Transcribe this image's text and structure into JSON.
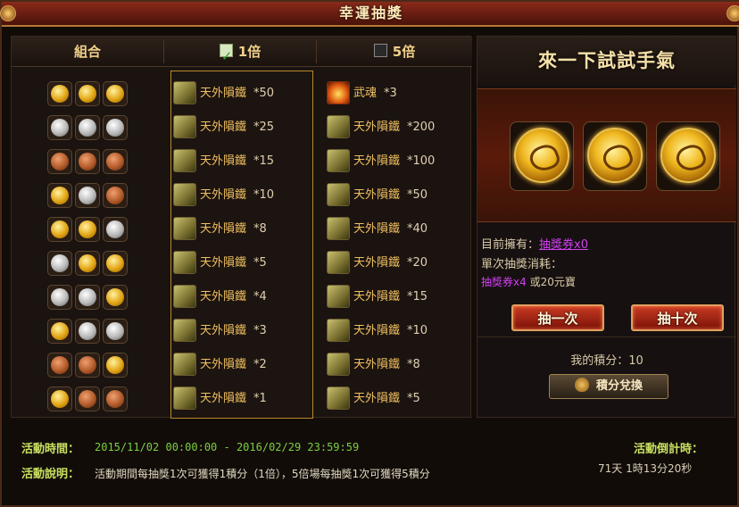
{
  "window": {
    "title": "幸運抽獎"
  },
  "table": {
    "headers": {
      "combo": "組合",
      "x1": "1倍",
      "x5": "5倍"
    },
    "x1_checked": true,
    "x5_checked": false,
    "rows": [
      {
        "coins": [
          "gold",
          "gold",
          "gold"
        ],
        "x1": {
          "name": "天外隕鐵",
          "qty": "*50"
        },
        "x5": {
          "name": "武魂",
          "qty": "*3",
          "icon": "fire-orb-icon"
        }
      },
      {
        "coins": [
          "silver",
          "silver",
          "silver"
        ],
        "x1": {
          "name": "天外隕鐵",
          "qty": "*25"
        },
        "x5": {
          "name": "天外隕鐵",
          "qty": "*200",
          "icon": "meteor-iron-icon"
        }
      },
      {
        "coins": [
          "bronze",
          "bronze",
          "bronze"
        ],
        "x1": {
          "name": "天外隕鐵",
          "qty": "*15"
        },
        "x5": {
          "name": "天外隕鐵",
          "qty": "*100",
          "icon": "meteor-iron-icon"
        }
      },
      {
        "coins": [
          "gold",
          "silver",
          "bronze"
        ],
        "x1": {
          "name": "天外隕鐵",
          "qty": "*10"
        },
        "x5": {
          "name": "天外隕鐵",
          "qty": "*50",
          "icon": "meteor-iron-icon"
        }
      },
      {
        "coins": [
          "gold",
          "gold",
          "silver"
        ],
        "x1": {
          "name": "天外隕鐵",
          "qty": "*8"
        },
        "x5": {
          "name": "天外隕鐵",
          "qty": "*40",
          "icon": "meteor-iron-icon"
        }
      },
      {
        "coins": [
          "silver",
          "gold",
          "gold"
        ],
        "x1": {
          "name": "天外隕鐵",
          "qty": "*5"
        },
        "x5": {
          "name": "天外隕鐵",
          "qty": "*20",
          "icon": "meteor-iron-icon"
        }
      },
      {
        "coins": [
          "silver",
          "silver",
          "gold"
        ],
        "x1": {
          "name": "天外隕鐵",
          "qty": "*4"
        },
        "x5": {
          "name": "天外隕鐵",
          "qty": "*15",
          "icon": "meteor-iron-icon"
        }
      },
      {
        "coins": [
          "gold",
          "silver",
          "silver"
        ],
        "x1": {
          "name": "天外隕鐵",
          "qty": "*3"
        },
        "x5": {
          "name": "天外隕鐵",
          "qty": "*10",
          "icon": "meteor-iron-icon"
        }
      },
      {
        "coins": [
          "bronze",
          "bronze",
          "gold"
        ],
        "x1": {
          "name": "天外隕鐵",
          "qty": "*2"
        },
        "x5": {
          "name": "天外隕鐵",
          "qty": "*8",
          "icon": "meteor-iron-icon"
        }
      },
      {
        "coins": [
          "gold",
          "bronze",
          "bronze"
        ],
        "x1": {
          "name": "天外隕鐵",
          "qty": "*1"
        },
        "x5": {
          "name": "天外隕鐵",
          "qty": "*5",
          "icon": "meteor-iron-icon"
        }
      }
    ]
  },
  "panel": {
    "title": "來一下試試手氣",
    "owned_label": "目前擁有：",
    "owned_value": "抽獎券x0",
    "cost_label": "單次抽獎消耗：",
    "cost_ticket": "抽獎券x4",
    "cost_or": " 或20元寶",
    "draw_one": "抽一次",
    "draw_ten": "抽十次",
    "score": "我的積分：10",
    "exchange": "積分兌換"
  },
  "footer": {
    "time_label": "活動時間：",
    "time_value": "2015/11/02 00:00:00 - 2016/02/29 23:59:59",
    "desc_label": "活動說明：",
    "desc_value": "活動期間每抽獎1次可獲得1積分（1倍），5倍場每抽獎1次可獲得5積分",
    "countdown_label": "活動倒計時：",
    "countdown_value": "71天 1時13分20秒"
  },
  "colors": {
    "accent_gold": "#f0c060",
    "link_purple": "#d040f0",
    "time_green": "#7ad040",
    "label_green": "#c8e060"
  }
}
